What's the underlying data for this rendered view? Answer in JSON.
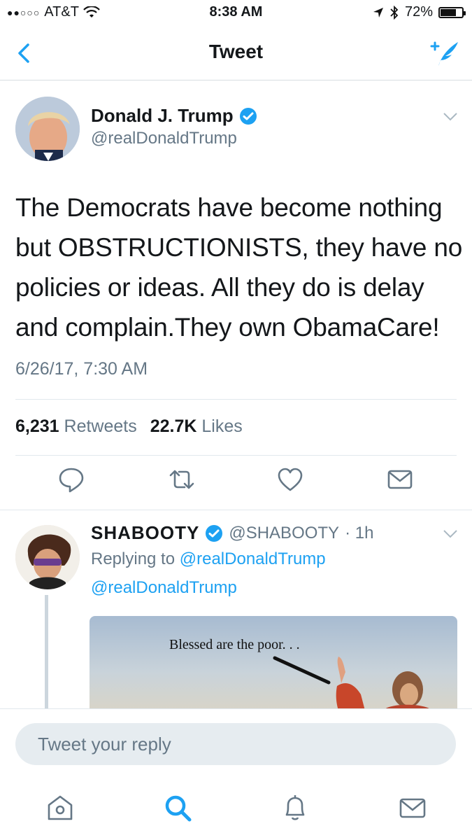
{
  "status_bar": {
    "carrier": "AT&T",
    "time": "8:38 AM",
    "battery": "72%"
  },
  "nav": {
    "title": "Tweet"
  },
  "tweet": {
    "author_name": "Donald J. Trump",
    "author_handle": "@realDonaldTrump",
    "text": "The Democrats have become nothing but OBSTRUCTIONISTS, they have no policies or ideas. All they do is delay and complain.They own ObamaCare!",
    "timestamp": "6/26/17, 7:30 AM",
    "retweets_count": "6,231",
    "retweets_label": "Retweets",
    "likes_count": "22.7K",
    "likes_label": "Likes"
  },
  "reply": {
    "author_name": "SHABOOTY",
    "author_handle": "@SHABOOTY",
    "age": "· 1h",
    "replying_prefix": "Replying to",
    "replying_to": "@realDonaldTrump",
    "mention": "@realDonaldTrump",
    "media_caption": "Blessed are the poor. . ."
  },
  "compose": {
    "placeholder": "Tweet your reply"
  },
  "colors": {
    "accent": "#1da1f2",
    "secondary_text": "#657786",
    "verified": "#1da1f2"
  },
  "icons": [
    "back-icon",
    "compose-icon",
    "verified-icon",
    "chevron-down-icon",
    "reply-icon",
    "retweet-icon",
    "like-icon",
    "direct-message-icon",
    "home-icon",
    "search-icon",
    "notifications-icon",
    "messages-icon"
  ]
}
